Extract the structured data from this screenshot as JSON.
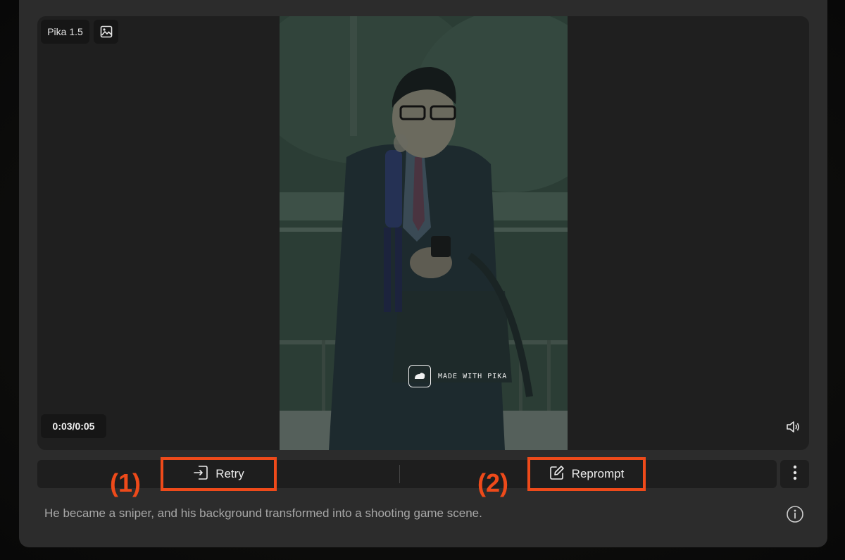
{
  "player": {
    "model_badge": "Pika 1.5",
    "image_icon": "image-icon",
    "time": "0:03/0:05",
    "volume_icon": "volume-icon",
    "watermark": "MADE WITH PIKA"
  },
  "actions": {
    "retry_label": "Retry",
    "retry_icon": "retry-icon",
    "reprompt_label": "Reprompt",
    "reprompt_icon": "edit-icon",
    "marker_1": "(1)",
    "marker_2": "(2)",
    "more_icon": "more-vertical-icon"
  },
  "prompt": {
    "text": "He became a sniper, and his background transformed into a shooting game scene.",
    "info_icon": "info-icon"
  },
  "colors": {
    "accent_highlight": "#ee4a1a",
    "card_bg": "#2c2c2c",
    "player_bg": "#1f1f1f"
  }
}
